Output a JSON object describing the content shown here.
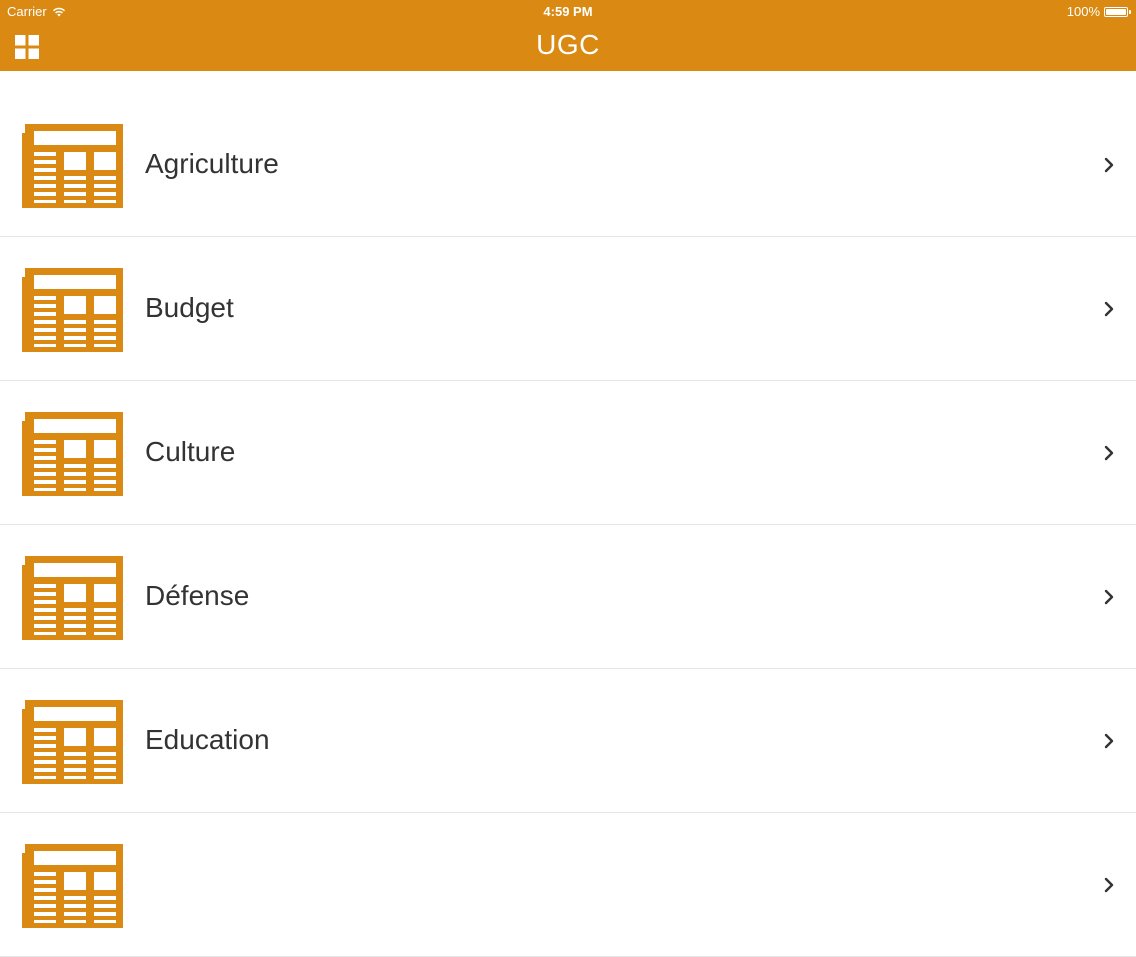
{
  "status_bar": {
    "carrier": "Carrier",
    "time": "4:59 PM",
    "battery": "100%",
    "battery_level": 1.0
  },
  "nav": {
    "title": "UGC",
    "menu_icon": "grid-icon"
  },
  "theme": {
    "accent": "#DA8A12",
    "text": "#333333",
    "divider": "#E6E6E6"
  },
  "list": {
    "row_icon": "newspaper-icon",
    "chevron_icon": "chevron-right-icon",
    "items": [
      {
        "label": "Agriculture"
      },
      {
        "label": "Budget"
      },
      {
        "label": "Culture"
      },
      {
        "label": "Défense"
      },
      {
        "label": "Education"
      },
      {
        "label": ""
      }
    ]
  }
}
